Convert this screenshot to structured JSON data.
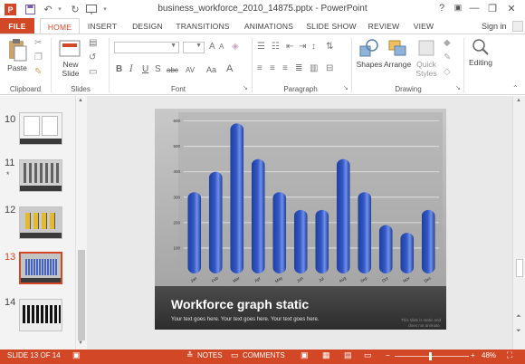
{
  "titlebar": {
    "title": "business_workforce_2010_14875.pptx - PowerPoint",
    "help": "?",
    "minimize": "—",
    "restore": "❐",
    "close": "✕"
  },
  "tabs": [
    {
      "label": "FILE"
    },
    {
      "label": "HOME"
    },
    {
      "label": "INSERT"
    },
    {
      "label": "DESIGN"
    },
    {
      "label": "TRANSITIONS"
    },
    {
      "label": "ANIMATIONS"
    },
    {
      "label": "SLIDE SHOW"
    },
    {
      "label": "REVIEW"
    },
    {
      "label": "VIEW"
    }
  ],
  "signin": "Sign in",
  "ribbon": {
    "clipboard": {
      "paste": "Paste",
      "label": "Clipboard"
    },
    "slides": {
      "new_slide_1": "New",
      "new_slide_2": "Slide",
      "label": "Slides"
    },
    "font": {
      "label": "Font",
      "bold": "B",
      "italic": "I",
      "underline": "U",
      "strike": "S",
      "shadow": "abc",
      "spacing": "AV",
      "case": "Aa",
      "grow": "A",
      "shrink": "A"
    },
    "paragraph": {
      "label": "Paragraph"
    },
    "drawing": {
      "label": "Drawing",
      "shapes": "Shapes",
      "arrange": "Arrange",
      "quick_1": "Quick",
      "quick_2": "Styles"
    },
    "editing": {
      "label": "Editing"
    }
  },
  "thumbnails": [
    {
      "num": "10",
      "star": false
    },
    {
      "num": "11",
      "star": true
    },
    {
      "num": "12",
      "star": false
    },
    {
      "num": "13",
      "star": false,
      "selected": true
    },
    {
      "num": "14",
      "star": false
    }
  ],
  "star_glyph": "*",
  "slide": {
    "title": "Workforce graph static",
    "subtitle": "Your text goes here. Your text goes here. Your text goes here.",
    "note": "This slide is static and does not animate."
  },
  "chart_data": {
    "type": "bar",
    "categories": [
      "Jan",
      "Feb",
      "Mar",
      "Apr",
      "May",
      "Jun",
      "Jul",
      "Aug",
      "Sep",
      "Oct",
      "Nov",
      "Dec"
    ],
    "values": [
      320,
      400,
      590,
      450,
      320,
      250,
      250,
      450,
      320,
      190,
      160,
      250
    ],
    "yticks": [
      100,
      200,
      300,
      400,
      500,
      600
    ],
    "ylim": [
      0,
      620
    ],
    "grid": true,
    "title": "",
    "xlabel": "",
    "ylabel": "",
    "bar_color": "#3358c4"
  },
  "status": {
    "slide": "SLIDE 13 OF 14",
    "notes": "NOTES",
    "comments": "COMMENTS",
    "zoom_minus": "−",
    "zoom_plus": "+",
    "zoom": "48%"
  },
  "colors": {
    "accent": "#d24726"
  }
}
